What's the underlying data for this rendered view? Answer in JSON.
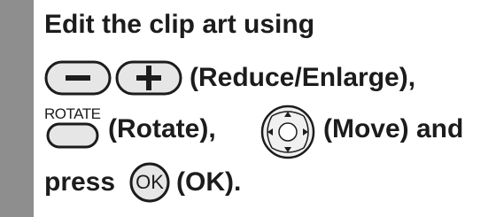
{
  "instruction": {
    "line1": "Edit the clip art using",
    "reduce_enlarge_label": "(Reduce/Enlarge),",
    "rotate_button_caption": "ROTATE",
    "rotate_label": "(Rotate),",
    "move_label": "(Move) and",
    "press_word": "press",
    "ok_button_text": "OK",
    "ok_label": "(OK)."
  },
  "icons": {
    "minus": "minus-button-icon",
    "plus": "plus-button-icon",
    "rotate": "rotate-button-icon",
    "move": "directional-pad-icon",
    "ok": "ok-button-icon"
  },
  "colors": {
    "sidebar": "#8e8e8e",
    "button_fill": "#e6e6e6",
    "text": "#1c1c1c"
  }
}
